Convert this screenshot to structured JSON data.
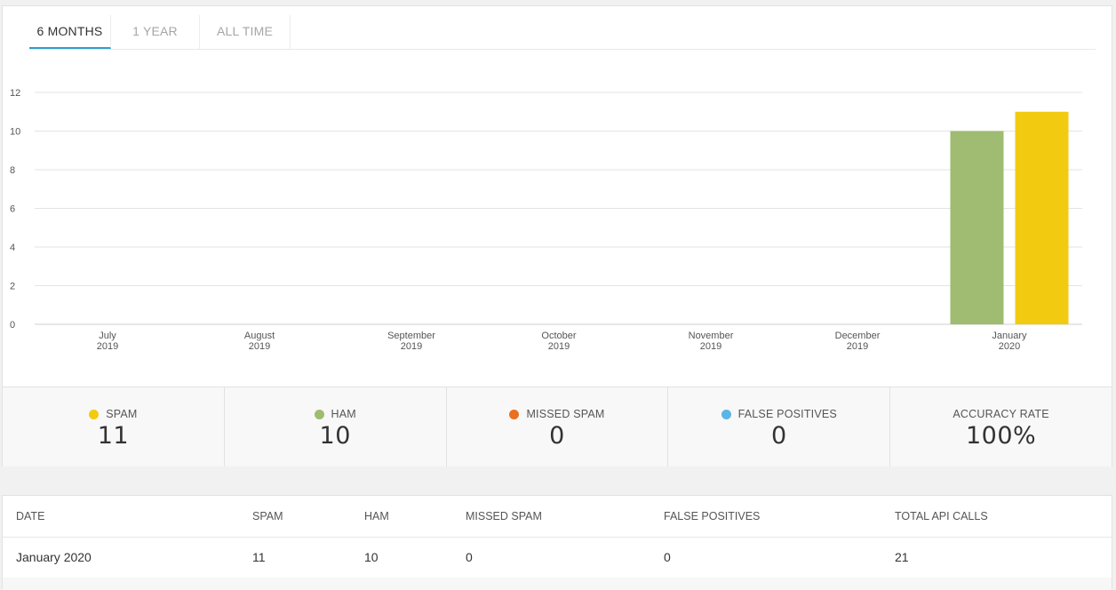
{
  "tabs": [
    {
      "label": "6 MONTHS",
      "active": true
    },
    {
      "label": "1 YEAR",
      "active": false
    },
    {
      "label": "ALL TIME",
      "active": false
    }
  ],
  "colors": {
    "spam": "#f2cb10",
    "ham": "#9fbc72",
    "missed_spam": "#ea6f1f",
    "false_positives": "#5bb5e6",
    "tab_accent": "#2f9bd3"
  },
  "chart_data": {
    "type": "bar",
    "categories": [
      [
        "July",
        "2019"
      ],
      [
        "August",
        "2019"
      ],
      [
        "September",
        "2019"
      ],
      [
        "October",
        "2019"
      ],
      [
        "November",
        "2019"
      ],
      [
        "December",
        "2019"
      ],
      [
        "January",
        "2020"
      ]
    ],
    "series": [
      {
        "name": "HAM",
        "color": "#9fbc72",
        "values": [
          0,
          0,
          0,
          0,
          0,
          0,
          10
        ]
      },
      {
        "name": "SPAM",
        "color": "#f2cb10",
        "values": [
          0,
          0,
          0,
          0,
          0,
          0,
          11
        ]
      }
    ],
    "yticks": [
      0,
      2,
      4,
      6,
      8,
      10,
      12
    ],
    "ylim": [
      0,
      12
    ],
    "grid": true,
    "legend": "none"
  },
  "stats": [
    {
      "label": "SPAM",
      "value": "11",
      "dot": "#f2cb10"
    },
    {
      "label": "HAM",
      "value": "10",
      "dot": "#9fbc72"
    },
    {
      "label": "MISSED SPAM",
      "value": "0",
      "dot": "#ea6f1f"
    },
    {
      "label": "FALSE POSITIVES",
      "value": "0",
      "dot": "#5bb5e6"
    },
    {
      "label": "ACCURACY RATE",
      "value": "100%",
      "dot": null
    }
  ],
  "table": {
    "columns": [
      "DATE",
      "SPAM",
      "HAM",
      "MISSED SPAM",
      "FALSE POSITIVES",
      "TOTAL API CALLS"
    ],
    "rows": [
      [
        "January 2020",
        "11",
        "10",
        "0",
        "0",
        "21"
      ]
    ]
  }
}
